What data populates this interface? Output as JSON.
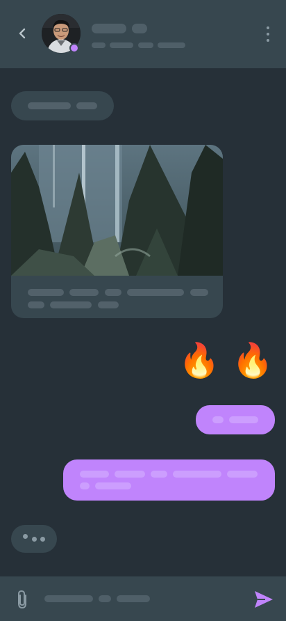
{
  "header": {
    "contact_name": "",
    "contact_status": "",
    "presence_color": "#c084fc",
    "back_icon": "chevron-left-icon",
    "menu_icon": "more-vertical-icon"
  },
  "conversation": {
    "incoming_bubble_color": "#37474f",
    "outgoing_bubble_color": "#c084fc",
    "reaction_emoji": "🔥 🔥"
  },
  "composer": {
    "placeholder": "",
    "attach_icon": "paperclip-icon",
    "send_icon": "send-icon"
  },
  "colors": {
    "background": "#263038",
    "surface": "#37474f",
    "accent": "#c084fc"
  }
}
